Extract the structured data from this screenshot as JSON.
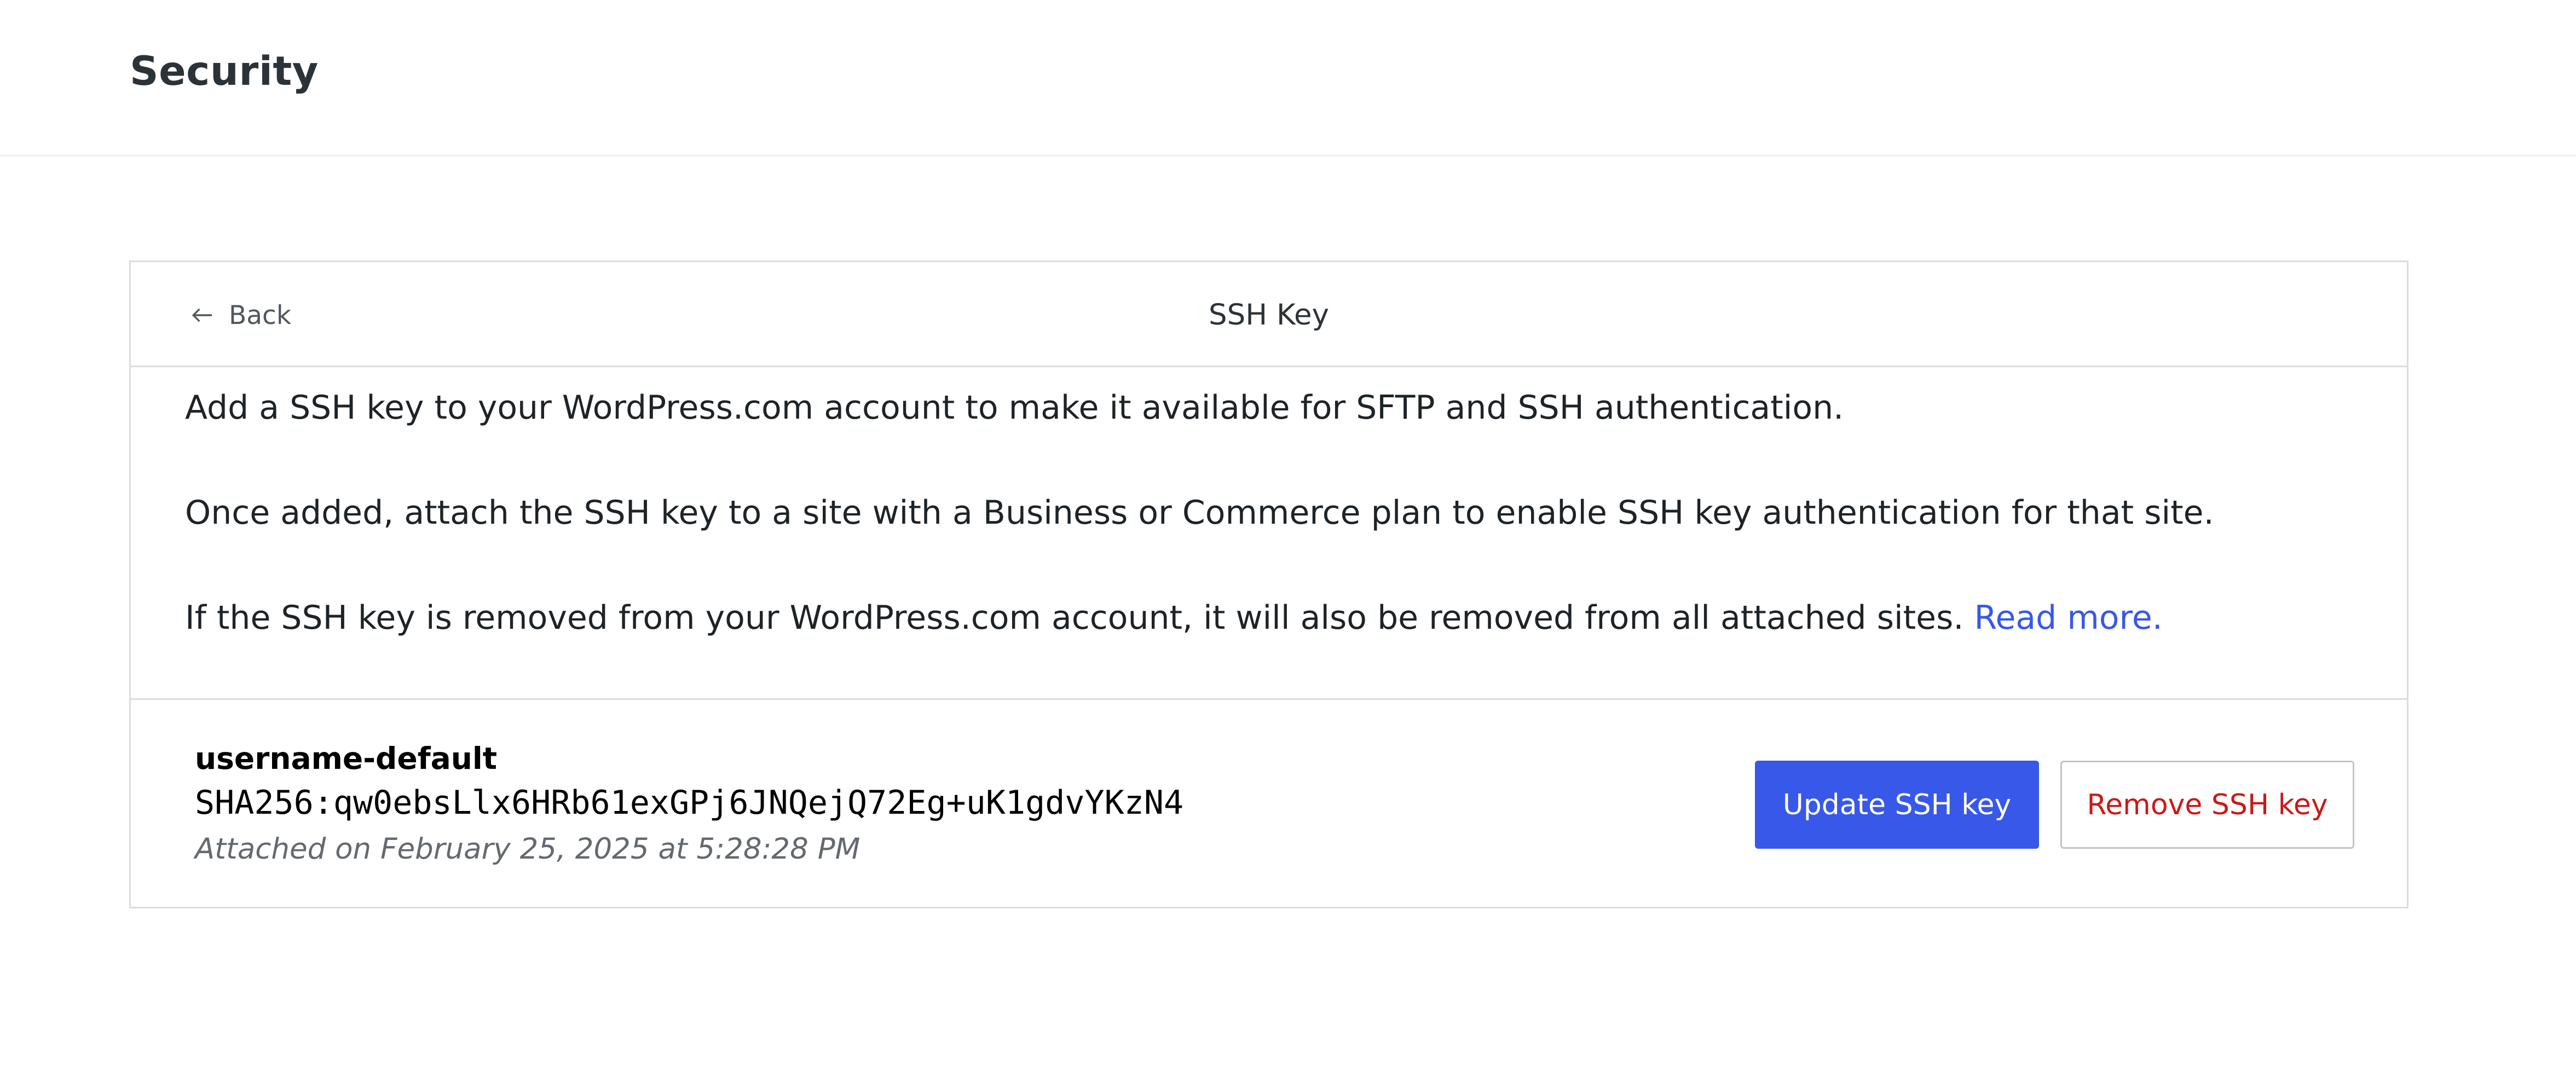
{
  "header": {
    "title": "Security"
  },
  "ssh_card": {
    "back_label": "Back",
    "title": "SSH Key",
    "description": {
      "line1": "Add a SSH key to your WordPress.com account to make it available for SFTP and SSH authentication.",
      "line2": "Once added, attach the SSH key to a site with a Business or Commerce plan to enable SSH key authentication for that site.",
      "line3": "If the SSH key is removed from your WordPress.com account, it will also be removed from all attached sites.",
      "read_more": "Read more."
    },
    "key": {
      "name": "username-default",
      "fingerprint": "SHA256:qw0ebsLlx6HRb61exGPj6JNQejQ72Eg+uK1gdvYKzN4",
      "attached": "Attached on February 25, 2025 at 5:28:28 PM"
    },
    "buttons": {
      "update_label": "Update SSH key",
      "remove_label": "Remove SSH key"
    }
  },
  "colors": {
    "accent": "#3858e9",
    "danger": "#cc1818",
    "border": "#dcdcde",
    "muted": "#646970"
  },
  "icons": {
    "back": "arrow-left-icon"
  }
}
